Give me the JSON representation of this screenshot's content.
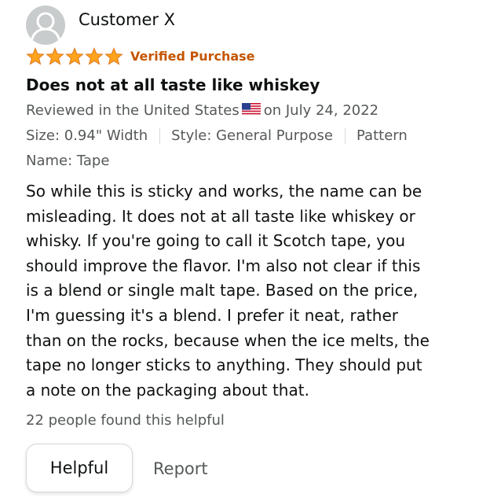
{
  "review": {
    "reviewer_name": "Customer X",
    "rating": 5,
    "rating_max": 5,
    "verified_label": "Verified Purchase",
    "title": "Does not at all taste like whiskey",
    "reviewed_in": "Reviewed in the United States",
    "reviewed_date": "on July 24, 2022",
    "variants": [
      "Size: 0.94\" Width",
      "Style: General Purpose",
      "Pattern"
    ],
    "name_label": "Name: Tape",
    "body_lines": [
      "So while this is sticky and works, the name can be",
      "misleading. It does not at all taste like whiskey or",
      "whisky. If you're going to call it Scotch tape, you",
      "should improve the flavor. I'm also not clear if this",
      "is a blend or single malt tape. Based on the price,",
      "I'm guessing it's a blend. I prefer it neat, rather",
      "than on the rocks, because when the ice melts, the",
      "tape no longer sticks to anything. They should put",
      "a note on the packaging about that."
    ],
    "helpful_count_text": "22 people found this helpful"
  },
  "actions": {
    "helpful_label": "Helpful",
    "report_label": "Report"
  },
  "colors": {
    "star": "#ffa41c",
    "verified": "#c45500",
    "secondary_text": "#565959",
    "avatar_bg": "#c9cccc"
  },
  "icons": {
    "avatar": "person-silhouette-icon",
    "star": "star-icon",
    "flag": "us-flag-icon"
  }
}
